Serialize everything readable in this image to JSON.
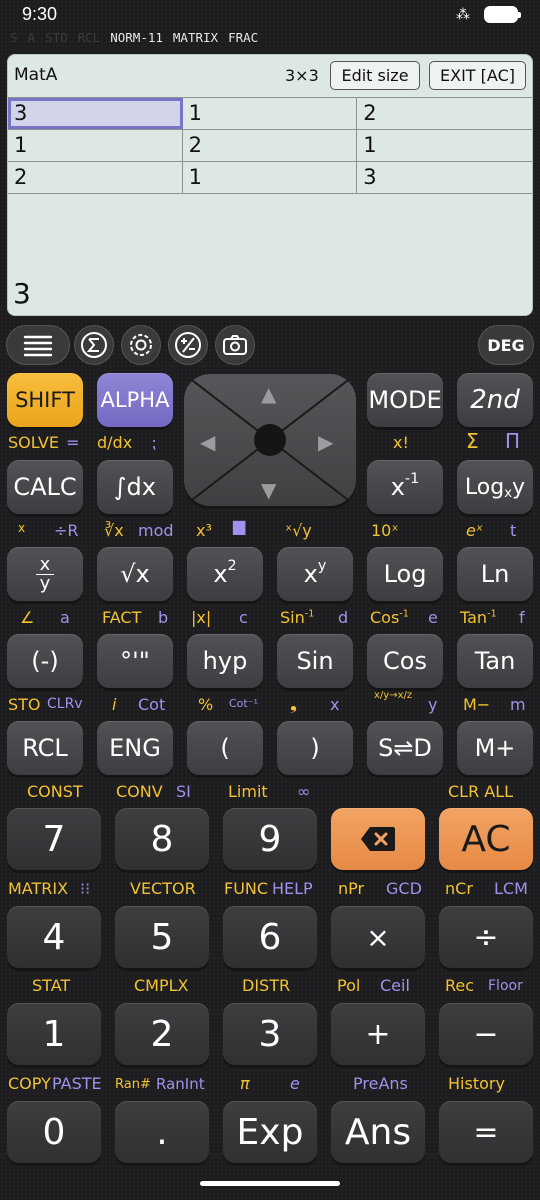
{
  "status": {
    "time": "9:30"
  },
  "indicators": {
    "dim": [
      "S",
      "A",
      "STO",
      "RCL"
    ],
    "active": [
      "NORM-11",
      "MATRIX",
      "FRAC"
    ]
  },
  "screen": {
    "matrix_name": "MatA",
    "dimension": "3×3",
    "edit_size_label": "Edit size",
    "exit_label": "EXIT [AC]",
    "rows": [
      [
        "3",
        "1",
        "2"
      ],
      [
        "1",
        "2",
        "1"
      ],
      [
        "2",
        "1",
        "3"
      ]
    ],
    "result": "3"
  },
  "toolbar": {
    "deg_label": "DEG"
  },
  "keys": {
    "shift": "SHIFT",
    "alpha": "ALPHA",
    "mode": "MODE",
    "second": "2nd",
    "calc": "CALC",
    "integral": "∫dx",
    "inverse_base": "x",
    "inverse_exp": "-1",
    "log_x_y_main": "Log",
    "log_x_y_sub": "x",
    "log_x_y_y": "y",
    "frac_top": "x",
    "frac_bottom": "y",
    "sqrt": "√x",
    "square_base": "x",
    "square_exp": "2",
    "power_base": "x",
    "power_exp": "y",
    "log": "Log",
    "ln": "Ln",
    "neg": "(-)",
    "deg_min_sec": "°'\"",
    "hyp": "hyp",
    "sin": "Sin",
    "cos": "Cos",
    "tan": "Tan",
    "rcl": "RCL",
    "eng": "ENG",
    "lparen": "(",
    "rparen": ")",
    "s_d": "S⇌D",
    "m_plus": "M+",
    "n7": "7",
    "n8": "8",
    "n9": "9",
    "ac": "AC",
    "n4": "4",
    "n5": "5",
    "n6": "6",
    "times": "×",
    "divide": "÷",
    "n1": "1",
    "n2": "2",
    "n3": "3",
    "plus": "+",
    "minus": "−",
    "n0": "0",
    "dot": ".",
    "exp": "Exp",
    "ans": "Ans",
    "equals": "="
  },
  "labels": {
    "solve": "SOLVE",
    "solve_eq": "=",
    "ddx": "d/dx",
    "ddx_p": "⁏",
    "fact_excl": "x!",
    "sigma": "Σ",
    "pi_prod": "Π",
    "frac_conv": "x",
    "frac_conv_p": "÷R",
    "cbrt": "∛x",
    "mod": "mod",
    "cube": "x³",
    "ten_pow": "10ˣ",
    "e_pow": "eˣ",
    "t": "t",
    "angle": "∠",
    "a": "a",
    "fact": "FACT",
    "b": "b",
    "abs": "|x|",
    "c": "c",
    "asin": "Sin",
    "asin_sup": "-1",
    "d": "d",
    "acos": "Cos",
    "acos_sup": "-1",
    "e": "e",
    "atan": "Tan",
    "atan_sup": "-1",
    "f": "f",
    "sto": "STO",
    "clrv": "CLRv",
    "i": "i",
    "cot": "Cot",
    "percent": "%",
    "acot": "Cot⁻¹",
    "comma": "❟",
    "x": "x",
    "y": "y",
    "m_minus": "M−",
    "m": "m",
    "const": "CONST",
    "conv": "CONV",
    "si": "SI",
    "limit": "Limit",
    "inf": "∞",
    "clr_all": "CLR ALL",
    "matrix": "MATRIX",
    "matrix_p": "⁝⁝",
    "vector": "VECTOR",
    "func": "FUNC",
    "help": "HELP",
    "npr": "nPr",
    "gcd": "GCD",
    "ncr": "nCr",
    "lcm": "LCM",
    "stat": "STAT",
    "cmplx": "CMPLX",
    "distr": "DISTR",
    "pol": "Pol",
    "ceil": "Ceil",
    "rec": "Rec",
    "floor": "Floor",
    "copy": "COPY",
    "paste": "PASTE",
    "ranhash": "Ran#",
    "ranint": "RanInt",
    "pi": "π",
    "e_const": "e",
    "preans": "PreAns",
    "history": "History"
  }
}
